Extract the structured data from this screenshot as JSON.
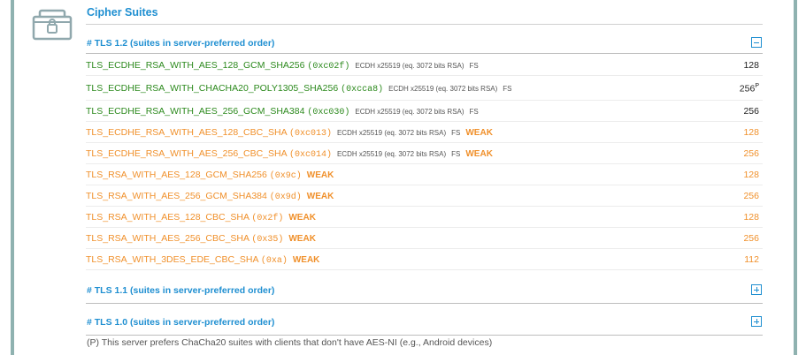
{
  "section": {
    "title": "Cipher Suites"
  },
  "groups": {
    "tls12": {
      "title": "# TLS 1.2 (suites in server-preferred order)",
      "state": "collapse"
    },
    "tls11": {
      "title": "# TLS 1.1 (suites in server-preferred order)",
      "state": "expand"
    },
    "tls10": {
      "title": "# TLS 1.0 (suites in server-preferred order)",
      "state": "expand"
    }
  },
  "suites": [
    {
      "name": "TLS_ECDHE_RSA_WITH_AES_128_GCM_SHA256",
      "hex": "(0xc02f)",
      "kx": "ECDH x25519 (eq. 3072 bits RSA)",
      "fs": "FS",
      "weak": "",
      "bits": "128",
      "note": "",
      "status": "good"
    },
    {
      "name": "TLS_ECDHE_RSA_WITH_CHACHA20_POLY1305_SHA256",
      "hex": "(0xcca8)",
      "kx": "ECDH x25519 (eq. 3072 bits RSA)",
      "fs": "FS",
      "weak": "",
      "bits": "256",
      "note": "P",
      "status": "good"
    },
    {
      "name": "TLS_ECDHE_RSA_WITH_AES_256_GCM_SHA384",
      "hex": "(0xc030)",
      "kx": "ECDH x25519 (eq. 3072 bits RSA)",
      "fs": "FS",
      "weak": "",
      "bits": "256",
      "note": "",
      "status": "good"
    },
    {
      "name": "TLS_ECDHE_RSA_WITH_AES_128_CBC_SHA",
      "hex": "(0xc013)",
      "kx": "ECDH x25519 (eq. 3072 bits RSA)",
      "fs": "FS",
      "weak": "WEAK",
      "bits": "128",
      "note": "",
      "status": "weak"
    },
    {
      "name": "TLS_ECDHE_RSA_WITH_AES_256_CBC_SHA",
      "hex": "(0xc014)",
      "kx": "ECDH x25519 (eq. 3072 bits RSA)",
      "fs": "FS",
      "weak": "WEAK",
      "bits": "256",
      "note": "",
      "status": "weak"
    },
    {
      "name": "TLS_RSA_WITH_AES_128_GCM_SHA256",
      "hex": "(0x9c)",
      "kx": "",
      "fs": "",
      "weak": "WEAK",
      "bits": "128",
      "note": "",
      "status": "weak"
    },
    {
      "name": "TLS_RSA_WITH_AES_256_GCM_SHA384",
      "hex": "(0x9d)",
      "kx": "",
      "fs": "",
      "weak": "WEAK",
      "bits": "256",
      "note": "",
      "status": "weak"
    },
    {
      "name": "TLS_RSA_WITH_AES_128_CBC_SHA",
      "hex": "(0x2f)",
      "kx": "",
      "fs": "",
      "weak": "WEAK",
      "bits": "128",
      "note": "",
      "status": "weak"
    },
    {
      "name": "TLS_RSA_WITH_AES_256_CBC_SHA",
      "hex": "(0x35)",
      "kx": "",
      "fs": "",
      "weak": "WEAK",
      "bits": "256",
      "note": "",
      "status": "weak"
    },
    {
      "name": "TLS_RSA_WITH_3DES_EDE_CBC_SHA",
      "hex": "(0xa)",
      "kx": "",
      "fs": "",
      "weak": "WEAK",
      "bits": "112",
      "note": "",
      "status": "weak"
    }
  ],
  "footnote": "(P) This server prefers ChaCha20 suites with clients that don't have AES-NI (e.g., Android devices)",
  "colors": {
    "accent": "#1f8fd1",
    "good": "#2d8a1e",
    "weak": "#f0902b",
    "frame": "#8fb2b0",
    "icon": "#90a8ad"
  },
  "icons": {
    "section": "lock-briefcase-icon",
    "collapse": "minus-square-icon",
    "expand": "plus-square-icon"
  }
}
